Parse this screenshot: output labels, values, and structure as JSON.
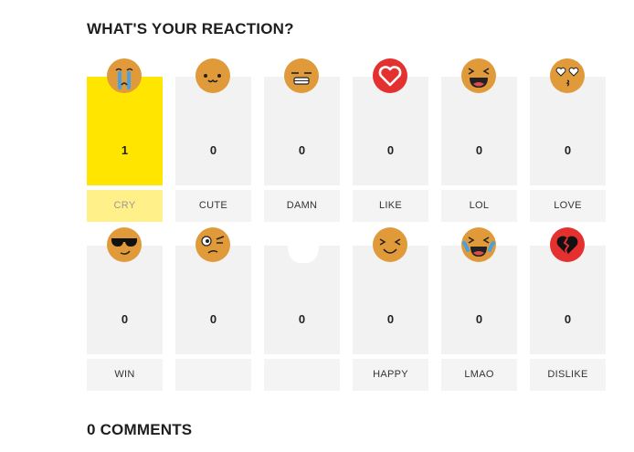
{
  "header": {
    "title": "WHAT'S YOUR REACTION?"
  },
  "reactions": [
    {
      "label": "CRY",
      "count": "1",
      "icon": "cry-icon",
      "active": true
    },
    {
      "label": "CUTE",
      "count": "0",
      "icon": "cute-icon",
      "active": false
    },
    {
      "label": "DAMN",
      "count": "0",
      "icon": "damn-icon",
      "active": false
    },
    {
      "label": "LIKE",
      "count": "0",
      "icon": "heart-icon",
      "active": false
    },
    {
      "label": "LOL",
      "count": "0",
      "icon": "lol-icon",
      "active": false
    },
    {
      "label": "LOVE",
      "count": "0",
      "icon": "love-icon",
      "active": false
    },
    {
      "label": "WIN",
      "count": "0",
      "icon": "win-icon",
      "active": false
    },
    {
      "label": "",
      "count": "0",
      "icon": "wtf-icon",
      "active": false
    },
    {
      "label": "",
      "count": "0",
      "icon": "blank-icon",
      "active": false
    },
    {
      "label": "HAPPY",
      "count": "0",
      "icon": "happy-icon",
      "active": false
    },
    {
      "label": "LMAO",
      "count": "0",
      "icon": "lmao-icon",
      "active": false
    },
    {
      "label": "DISLIKE",
      "count": "0",
      "icon": "broken-heart-icon",
      "active": false
    }
  ],
  "footer": {
    "comments_title": "0 COMMENTS"
  },
  "colors": {
    "active": "#ffe500",
    "active_label": "#fff08a",
    "face": "#e09a3a",
    "heart": "#e53030"
  }
}
